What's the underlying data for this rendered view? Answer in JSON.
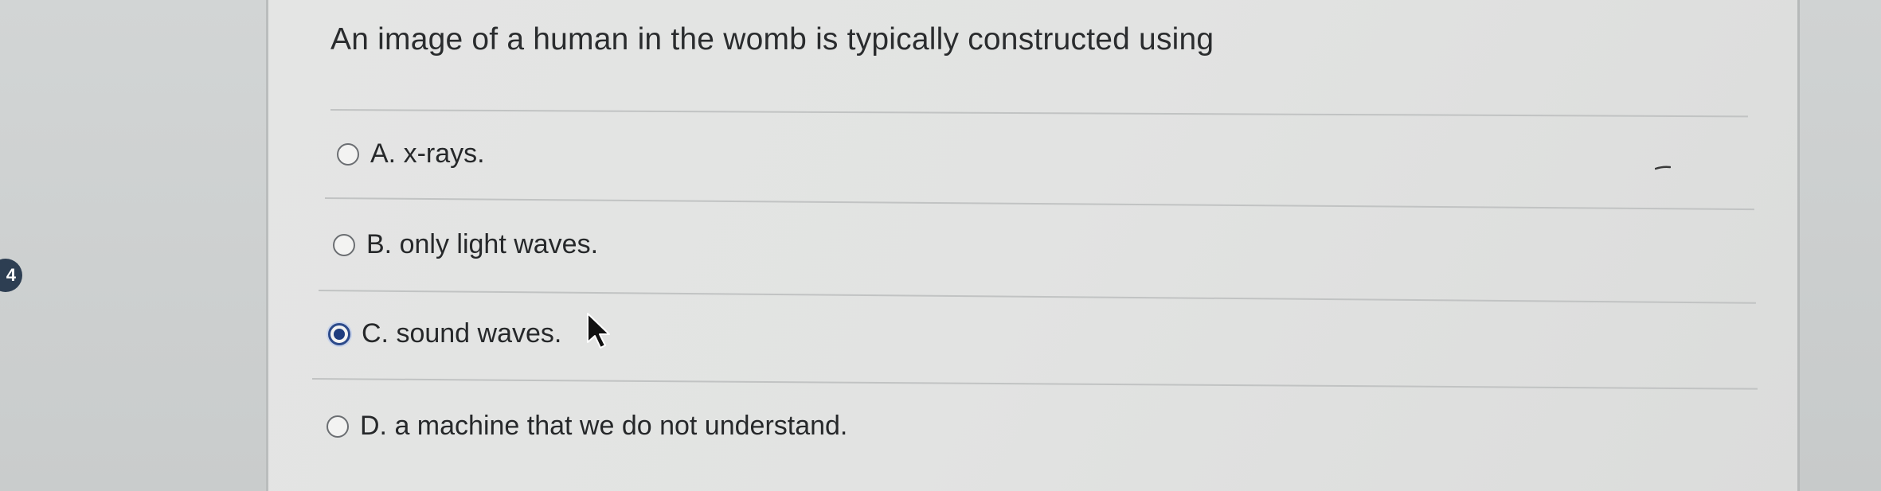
{
  "sidebar": {
    "question_number": "4"
  },
  "question": {
    "prompt": "An image of a human in the womb is typically constructed using",
    "selected_index": 2,
    "options": [
      {
        "label": "A. x-rays.",
        "selected": false
      },
      {
        "label": "B. only light waves.",
        "selected": false
      },
      {
        "label": "C. sound waves.",
        "selected": true
      },
      {
        "label": "D. a machine that we do not understand.",
        "selected": false
      }
    ]
  },
  "colors": {
    "radio_selected": "#1f3d7e",
    "question_badge": "#2d3e52",
    "text": "#26282a"
  },
  "icons": {
    "cursor": "mouse-pointer-icon"
  }
}
